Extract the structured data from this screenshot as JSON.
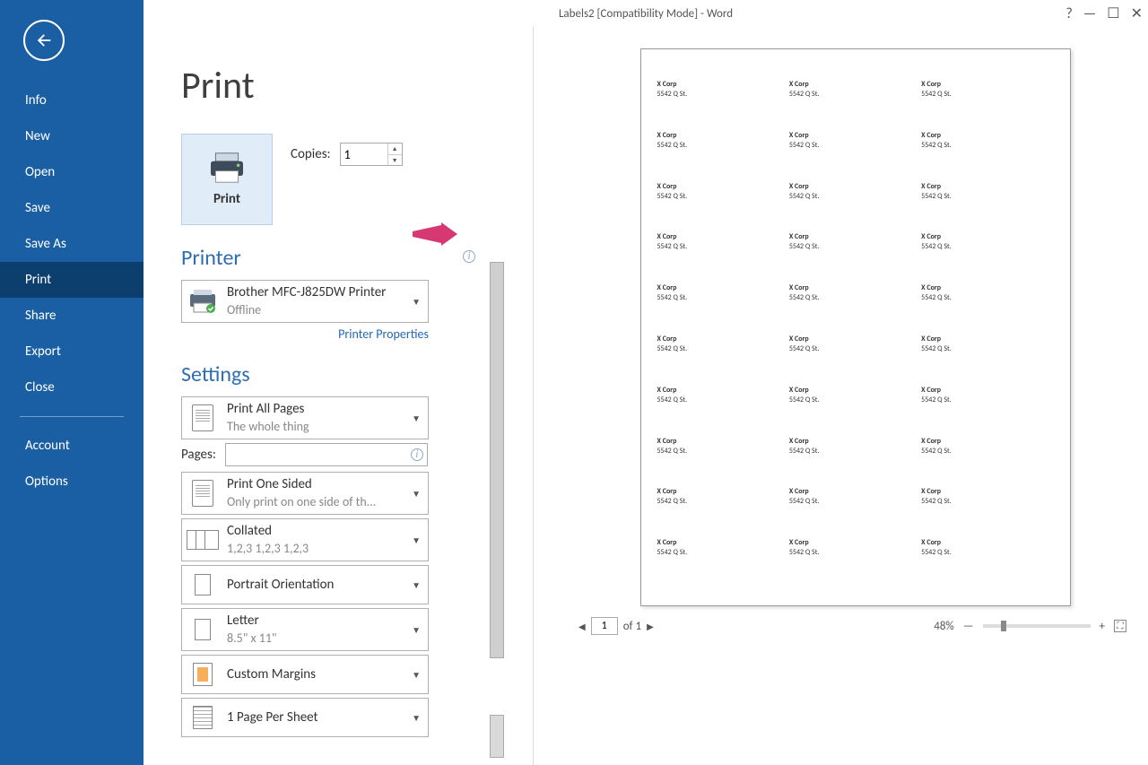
{
  "window": {
    "title": "Labels2 [Compatibility Mode] - Word"
  },
  "sidebar": {
    "items": [
      {
        "label": "Info"
      },
      {
        "label": "New"
      },
      {
        "label": "Open"
      },
      {
        "label": "Save"
      },
      {
        "label": "Save As"
      },
      {
        "label": "Print",
        "active": true
      },
      {
        "label": "Share"
      },
      {
        "label": "Export"
      },
      {
        "label": "Close"
      }
    ],
    "footer": [
      {
        "label": "Account"
      },
      {
        "label": "Options"
      }
    ]
  },
  "heading": "Print",
  "print_button": "Print",
  "copies": {
    "label": "Copies:",
    "value": "1"
  },
  "printer_section": {
    "title": "Printer",
    "name": "Brother MFC-J825DW Printer",
    "status": "Offline",
    "link": "Printer Properties"
  },
  "settings_section": {
    "title": "Settings",
    "print_all": {
      "main": "Print All Pages",
      "sub": "The whole thing"
    },
    "pages_label": "Pages:",
    "pages_value": "",
    "sided": {
      "main": "Print One Sided",
      "sub": "Only print on one side of th..."
    },
    "collate": {
      "main": "Collated",
      "sub": "1,2,3    1,2,3    1,2,3"
    },
    "orient": {
      "main": "Portrait Orientation"
    },
    "paper": {
      "main": "Letter",
      "sub": "8.5\" x 11\""
    },
    "margins": {
      "main": "Custom Margins"
    },
    "ppsheet": {
      "main": "1 Page Per Sheet"
    }
  },
  "preview": {
    "label": {
      "line1": "X Corp",
      "line2": "5542 Q St."
    },
    "rows": 10,
    "cols": 3,
    "page_current": "1",
    "page_total": "of 1",
    "zoom": "48%"
  }
}
